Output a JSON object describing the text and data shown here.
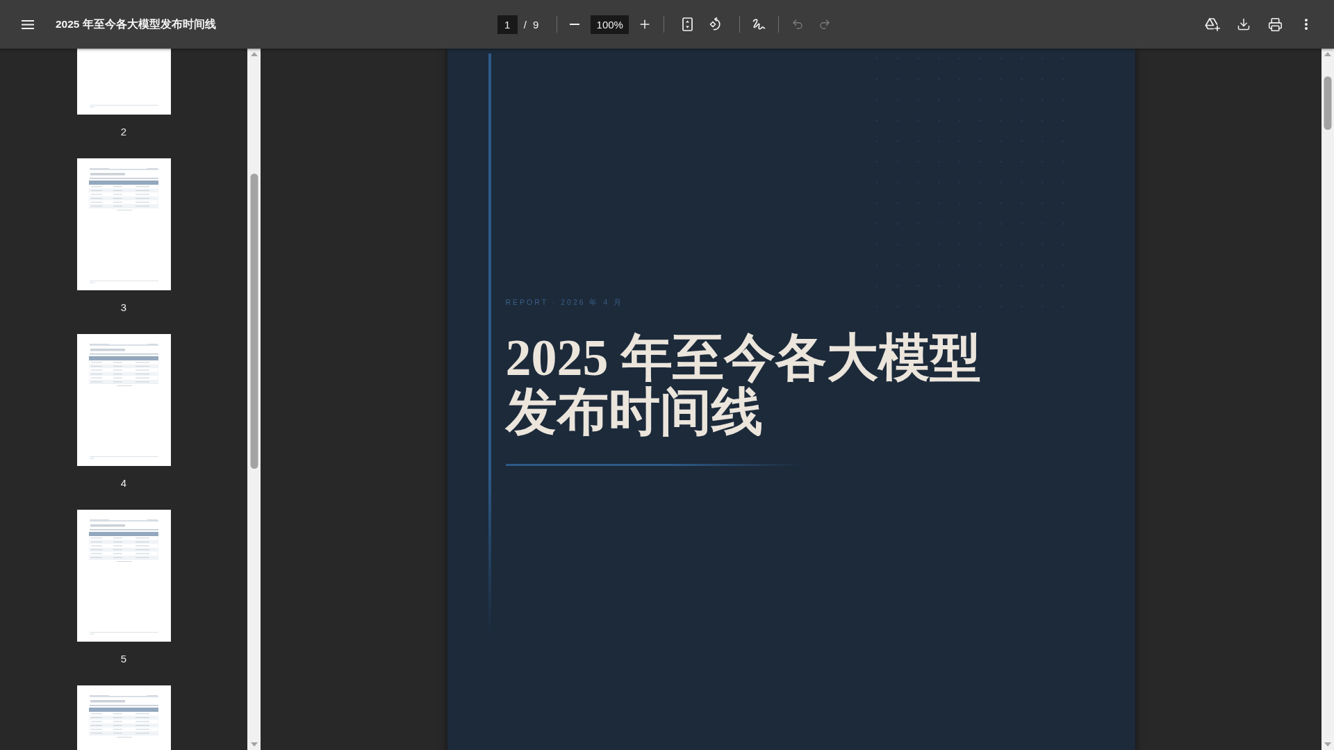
{
  "toolbar": {
    "title": "2025 年至今各大模型发布时间线",
    "page_input": "1",
    "page_separator": "/",
    "page_total": "9",
    "zoom": "100%",
    "undo": {
      "disabled": true
    },
    "redo": {
      "disabled": true
    }
  },
  "sidebar": {
    "thumbnails": [
      {
        "kind": "blank",
        "label": "2",
        "selected": false
      },
      {
        "kind": "table",
        "label": "3",
        "selected": false
      },
      {
        "kind": "table",
        "label": "4",
        "selected": false
      },
      {
        "kind": "table",
        "label": "5",
        "selected": false
      },
      {
        "kind": "table",
        "selected": false
      }
    ]
  },
  "document": {
    "eyebrow": "REPORT · 2026 年 4 月",
    "title": "2025 年至今各大模型发布时间线"
  }
}
